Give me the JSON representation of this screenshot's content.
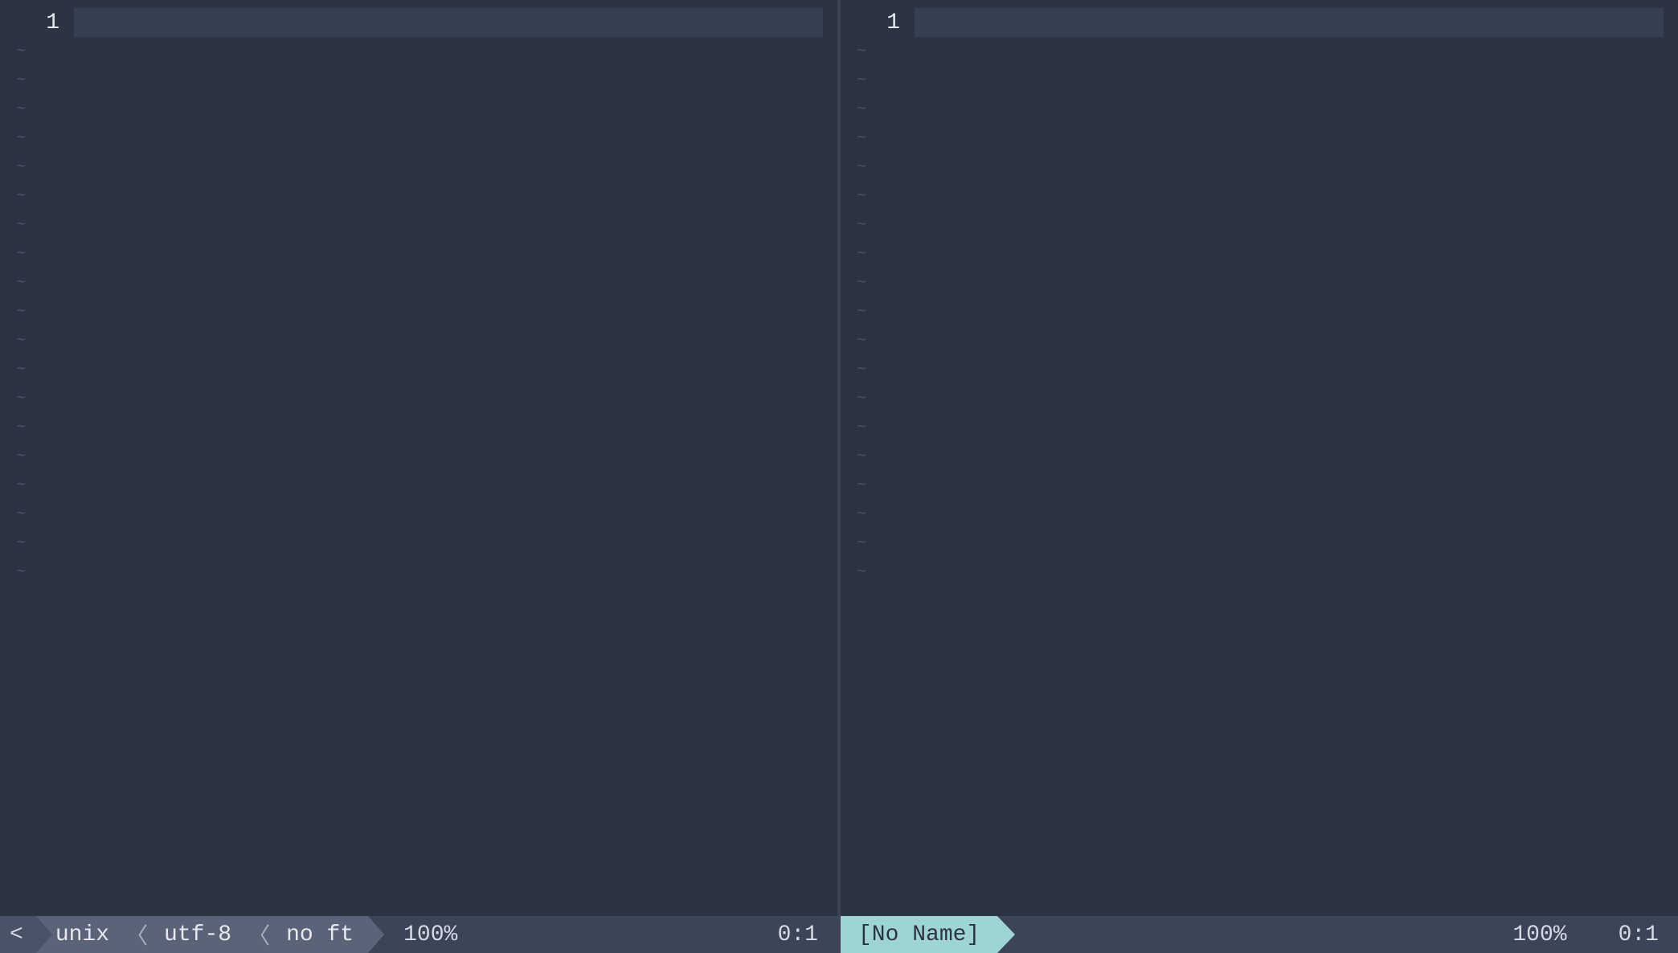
{
  "tilde": "~",
  "panes": {
    "left": {
      "line_number": "1",
      "empty_rows": 19
    },
    "right": {
      "line_number": "1",
      "empty_rows": 19
    }
  },
  "statusline": {
    "left": {
      "mode": "<",
      "file_format": "unix",
      "encoding": "utf-8",
      "filetype": "no ft",
      "percent": "100%",
      "position": "0:1"
    },
    "right": {
      "filename": "[No Name]",
      "percent": "100%",
      "position": "0:1"
    }
  }
}
